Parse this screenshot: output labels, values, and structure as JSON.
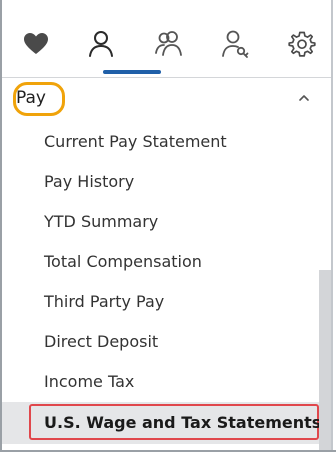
{
  "nav_icons": [
    {
      "name": "favorites-icon",
      "active": false
    },
    {
      "name": "person-icon",
      "active": true
    },
    {
      "name": "people-icon",
      "active": false
    },
    {
      "name": "person-key-icon",
      "active": false
    },
    {
      "name": "gear-icon",
      "active": false
    }
  ],
  "colors": {
    "accent": "#1f5fa8",
    "highlight_ring": "#f0a30a",
    "selection_box": "#e0474c"
  },
  "section": {
    "title": "Pay",
    "expanded": true,
    "chevron_icon": "chevron-up-icon"
  },
  "menu": {
    "items": [
      {
        "label": "Current Pay Statement"
      },
      {
        "label": "Pay History"
      },
      {
        "label": "YTD Summary"
      },
      {
        "label": "Total Compensation"
      },
      {
        "label": "Third Party Pay"
      },
      {
        "label": "Direct Deposit"
      },
      {
        "label": "Income Tax"
      },
      {
        "label": "U.S. Wage and Tax Statements",
        "selected": true
      }
    ]
  }
}
